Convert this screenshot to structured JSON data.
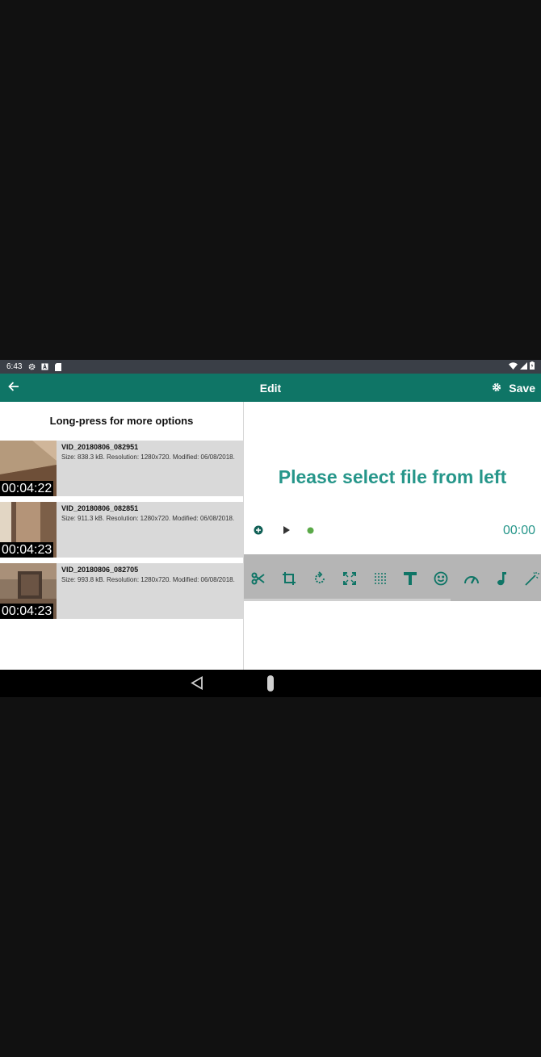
{
  "status_bar": {
    "time": "6:43",
    "left_icons": [
      "settings-icon",
      "a-badge-icon",
      "sd-card-icon"
    ],
    "right_icons": [
      "wifi-icon",
      "signal-icon",
      "battery-icon"
    ]
  },
  "app_bar": {
    "back_icon": "arrow-back-icon",
    "title": "Edit",
    "settings_icon": "gear-icon",
    "save_label": "Save",
    "color": "#0f7566"
  },
  "left_panel": {
    "hint": "Long-press for more options",
    "files": [
      {
        "name": "VID_20180806_082951",
        "meta": "Size: 838.3 kB. Resolution: 1280x720. Modified: 06/08/2018.",
        "duration": "00:04:22"
      },
      {
        "name": "VID_20180806_082851",
        "meta": "Size: 911.3 kB. Resolution: 1280x720. Modified: 06/08/2018.",
        "duration": "00:04:23"
      },
      {
        "name": "VID_20180806_082705",
        "meta": "Size: 993.8 kB. Resolution: 1280x720. Modified: 06/08/2018.",
        "duration": "00:04:23"
      }
    ]
  },
  "right_panel": {
    "placeholder": "Please select file from left",
    "playback_time": "00:00",
    "accent": "#26968a",
    "tools": [
      "scissors-icon",
      "crop-icon",
      "rotate-icon",
      "fullscreen-icon",
      "mosaic-icon",
      "text-icon",
      "emoji-icon",
      "speed-icon",
      "music-note-icon",
      "magic-wand-icon"
    ]
  },
  "nav_bar": {
    "icons": [
      "nav-back-icon",
      "nav-home-icon"
    ]
  }
}
